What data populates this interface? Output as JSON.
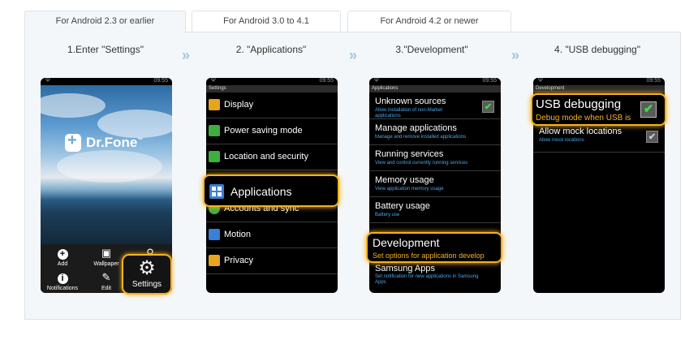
{
  "tabs": [
    {
      "label": "For Android 2.3 or earlier",
      "active": true
    },
    {
      "label": "For Android 3.0 to 4.1",
      "active": false
    },
    {
      "label": "For Android 4.2 or newer",
      "active": false
    }
  ],
  "steps": [
    {
      "title": "1.Enter \"Settings\""
    },
    {
      "title": "2. \"Applications\""
    },
    {
      "title": "3.\"Development\""
    },
    {
      "title": "4. \"USB debugging\""
    }
  ],
  "arrow": "»",
  "status_time": "09:55",
  "phone1": {
    "brand": "Dr.Fone",
    "trademark": "™",
    "dock": [
      {
        "label": "Add",
        "icon": "add-icon"
      },
      {
        "label": "Wallpaper",
        "icon": "wallpaper-icon"
      },
      {
        "label": "Notifications",
        "icon": "info-icon"
      },
      {
        "label": "Edit",
        "icon": "edit-icon"
      }
    ],
    "settings_label": "Settings"
  },
  "phone2": {
    "header": "Settings",
    "items": [
      {
        "label": "Display",
        "icon": "display-icon",
        "color": "#e5a51c"
      },
      {
        "label": "Power saving mode",
        "icon": "power-saving-icon",
        "color": "#3fae3f"
      },
      {
        "label": "Location and security",
        "icon": "location-icon",
        "color": "#3fae3f"
      },
      {
        "label": "Applications",
        "icon": "applications-icon",
        "color": "#3b7fd6"
      },
      {
        "label": "Accounts and sync",
        "icon": "sync-icon",
        "color": "#3fae3f"
      },
      {
        "label": "Motion",
        "icon": "motion-icon",
        "color": "#3b7fd6"
      },
      {
        "label": "Privacy",
        "icon": "privacy-icon",
        "color": "#e5a51c"
      }
    ]
  },
  "phone3": {
    "header": "Applications",
    "items": [
      {
        "title": "Unknown sources",
        "sub": "Allow installation of non-Market applications",
        "checked": true
      },
      {
        "title": "Manage applications",
        "sub": "Manage and remove installed applications"
      },
      {
        "title": "Running services",
        "sub": "View and control currently running services"
      },
      {
        "title": "Memory usage",
        "sub": "View application memory usage"
      },
      {
        "title": "Battery usage",
        "sub": "Battery use"
      },
      {
        "title": "Development",
        "sub": "Set options for application develop"
      },
      {
        "title": "Samsung Apps",
        "sub": "Set notification for new applications in Samsung Apps"
      }
    ]
  },
  "phone4": {
    "header": "Development",
    "items": [
      {
        "title": "USB debugging",
        "sub": "Debug mode when USB is",
        "checked": true
      },
      {
        "title": "Allow mock locations",
        "sub": "Allow mock locations",
        "checked": true
      }
    ]
  },
  "colors": {
    "accent": "#f6b21b",
    "link_blue": "#48a8e8",
    "check_green": "#3ddc4a"
  }
}
